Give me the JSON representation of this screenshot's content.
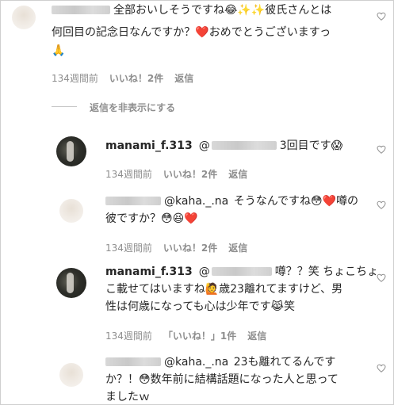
{
  "comment_main": {
    "line1": "全部おいしそうですね😂✨✨彼氏さんとは",
    "line2": "何回目の記念日なんですか？❤️おめでとうございますっ",
    "line3": "🙏",
    "time": "134週間前",
    "likes": "いいね！2件",
    "reply": "返信"
  },
  "hide_replies": "返信を非表示にする",
  "reply1": {
    "username": "manami_f.313",
    "mention": "@",
    "text": "3回目です😱",
    "time": "134週間前",
    "likes": "いいね！2件",
    "reply": "返信"
  },
  "reply2": {
    "mention": "@kaha._.na",
    "line1": "そうなんですね😳❤️噂の",
    "line2": "彼ですか？😳😆❤️",
    "time": "134週間前",
    "likes": "いいね！2件",
    "reply": "返信"
  },
  "reply3": {
    "username": "manami_f.313",
    "mention": "@",
    "line1": "噂？？笑 ちょこちょ",
    "line2": "こ載せてはいますね🙋歳23離れてますけど、男",
    "line3": "性は何歳になっても心は少年です😹笑",
    "time": "134週間前",
    "likes": "「いいね！」1件",
    "reply": "返信"
  },
  "reply4": {
    "mention": "@kaha._.na",
    "line1": "23も離れてるんです",
    "line2": "か？！😳数年前に結構話題になった人と思って",
    "line3": "ましたｗ"
  },
  "colors": {
    "text": "#262626",
    "meta": "#8e8e8e",
    "heart": "#ed4956"
  }
}
